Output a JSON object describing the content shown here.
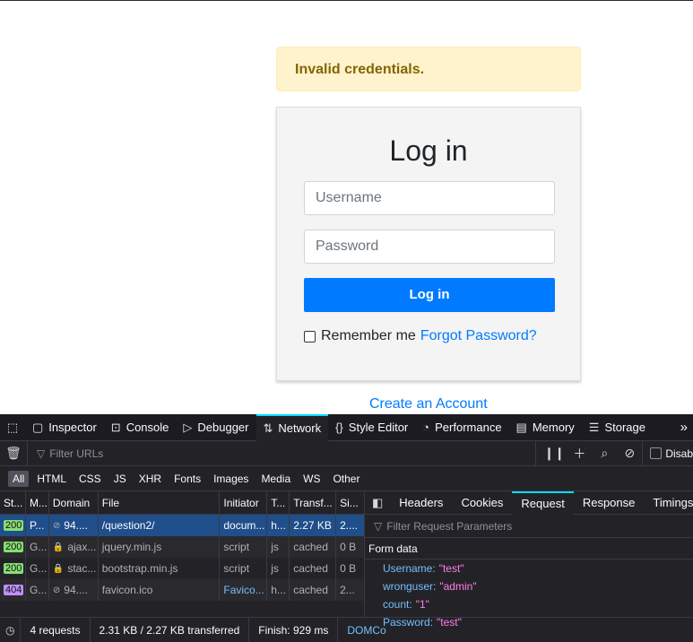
{
  "page": {
    "alert": "Invalid credentials.",
    "card_title": "Log in",
    "username_placeholder": "Username",
    "password_placeholder": "Password",
    "login_button": "Log in",
    "remember_label": "Remember me",
    "forgot_link": "Forgot Password?",
    "create_account": "Create an Account",
    "colors": {
      "primary": "#007bff",
      "alert_bg": "#fff3cd",
      "alert_text": "#856404"
    }
  },
  "devtools": {
    "tabs": [
      {
        "label": "Inspector",
        "icon": "inspector-icon"
      },
      {
        "label": "Console",
        "icon": "console-icon"
      },
      {
        "label": "Debugger",
        "icon": "debugger-icon"
      },
      {
        "label": "Network",
        "icon": "network-icon",
        "active": true
      },
      {
        "label": "Style Editor",
        "icon": "style-editor-icon"
      },
      {
        "label": "Performance",
        "icon": "performance-icon"
      },
      {
        "label": "Memory",
        "icon": "memory-icon"
      },
      {
        "label": "Storage",
        "icon": "storage-icon"
      }
    ],
    "filter_placeholder": "Filter URLs",
    "disable_label": "Disab",
    "types": [
      "All",
      "HTML",
      "CSS",
      "JS",
      "XHR",
      "Fonts",
      "Images",
      "Media",
      "WS",
      "Other"
    ],
    "columns": [
      "St...",
      "M...",
      "Domain",
      "File",
      "Initiator",
      "T...",
      "Transf...",
      "Si..."
    ],
    "rows": [
      {
        "status": "200",
        "method": "P...",
        "domain": "94....",
        "file": "/question2/",
        "initiator": "docum...",
        "type": "h...",
        "transferred": "2.27 KB",
        "size": "2...."
      },
      {
        "status": "200",
        "method": "G...",
        "domain": "ajax...",
        "file": "jquery.min.js",
        "initiator": "script",
        "type": "js",
        "transferred": "cached",
        "size": "0 B"
      },
      {
        "status": "200",
        "method": "G...",
        "domain": "stac...",
        "file": "bootstrap.min.js",
        "initiator": "script",
        "type": "js",
        "transferred": "cached",
        "size": "0 B"
      },
      {
        "status": "404",
        "method": "G...",
        "domain": "94....",
        "file": "favicon.ico",
        "initiator": "Favico...",
        "type": "h...",
        "transferred": "cached",
        "size": "2..."
      }
    ],
    "detail_tabs": [
      "Headers",
      "Cookies",
      "Request",
      "Response",
      "Timings"
    ],
    "detail_filter_placeholder": "Filter Request Parameters",
    "form_title": "Form data",
    "params": [
      {
        "key": "Username:",
        "value": "\"test\""
      },
      {
        "key": "wronguser:",
        "value": "\"admin\""
      },
      {
        "key": "count:",
        "value": "\"1\""
      },
      {
        "key": "Password:",
        "value": "\"test\""
      }
    ],
    "status": {
      "requests": "4 requests",
      "transferred": "2.31 KB / 2.27 KB transferred",
      "finish": "Finish: 929 ms",
      "dom": "DOMCo"
    }
  }
}
